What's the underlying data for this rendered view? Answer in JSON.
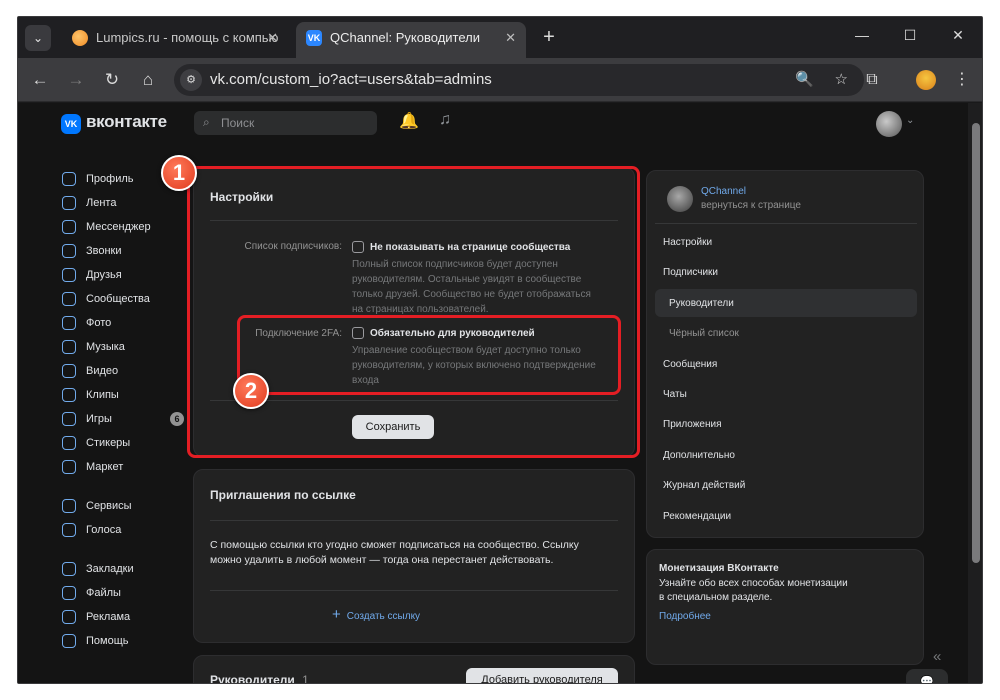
{
  "browser": {
    "tabs": [
      {
        "title": "Lumpics.ru - помощь с компью",
        "close": "✕"
      },
      {
        "title": "QChannel: Руководители",
        "close": "✕",
        "favicon_text": "VK"
      }
    ],
    "new_tab": "+",
    "menu_glyph": "⌄",
    "window_controls": [
      "—",
      "☐",
      "✕"
    ],
    "nav": {
      "back": "←",
      "forward": "→",
      "reload": "↻",
      "home": "⌂"
    },
    "url": "vk.com/custom_io?act=users&tab=admins",
    "site_info_icon": "⚙",
    "zoom_icon": "🔍",
    "bookmark_icon": "☆",
    "extensions_icon": "⧉",
    "kebab_icon": "⋮"
  },
  "vk": {
    "logo_text": "VK",
    "brand": "вконтакте",
    "search_placeholder": "Поиск",
    "bell_icon": "🔔",
    "music_icon": "♫",
    "avatar_chevron": "⌄"
  },
  "leftnav": {
    "group1": [
      "Профиль",
      "Лента",
      "Мессенджер",
      "Звонки",
      "Друзья",
      "Сообщества",
      "Фото",
      "Музыка",
      "Видео",
      "Клипы",
      "Игры",
      "Стикеры",
      "Маркет"
    ],
    "games_badge": "6",
    "group2": [
      "Сервисы",
      "Голоса"
    ],
    "group3": [
      "Закладки",
      "Файлы",
      "Реклама",
      "Помощь"
    ]
  },
  "settings": {
    "title": "Настройки",
    "subscribers_label": "Список подписчиков:",
    "subscribers_checkbox": "Не показывать на странице сообщества",
    "subscribers_hint": [
      "Полный список подписчиков будет доступен",
      "руководителям. Остальные увидят в сообществе",
      "только друзей. Сообщество не будет отображаться",
      "на страницах пользователей."
    ],
    "twofa_label": "Подключение 2FA:",
    "twofa_checkbox": "Обязательно для руководителей",
    "twofa_hint": [
      "Управление сообществом будет доступно только",
      "руководителям, у которых включено подтверждение",
      "входа"
    ],
    "save": "Сохранить"
  },
  "invites": {
    "title": "Приглашения по ссылке",
    "text": [
      "С помощью ссылки кто угодно сможет подписаться на сообщество. Ссылку",
      "можно удалить в любой момент — тогда она перестанет действовать."
    ],
    "create_icon": "+",
    "create": "Создать ссылку"
  },
  "managers": {
    "title": "Руководители",
    "count": "1",
    "add": "Добавить руководителя"
  },
  "right_menu": {
    "group_name": "QChannel",
    "back": "вернуться к странице",
    "items": [
      "Настройки",
      "Подписчики",
      "Руководители",
      "Чёрный список",
      "Сообщения",
      "Чаты",
      "Приложения",
      "Дополнительно",
      "Журнал действий",
      "Рекомендации"
    ]
  },
  "monetization": {
    "title": "Монетизация ВКонтакте",
    "text": [
      "Узнайте обо всех способах монетизации",
      "в специальном разделе."
    ],
    "link": "Подробнее"
  },
  "collapse_icon": "«",
  "chat_icon": "💬",
  "annotations": {
    "one": "1",
    "two": "2"
  },
  "colors": {
    "accent": "#71aaeb",
    "highlight": "#e41e24",
    "vk_blue": "#0077ff"
  }
}
